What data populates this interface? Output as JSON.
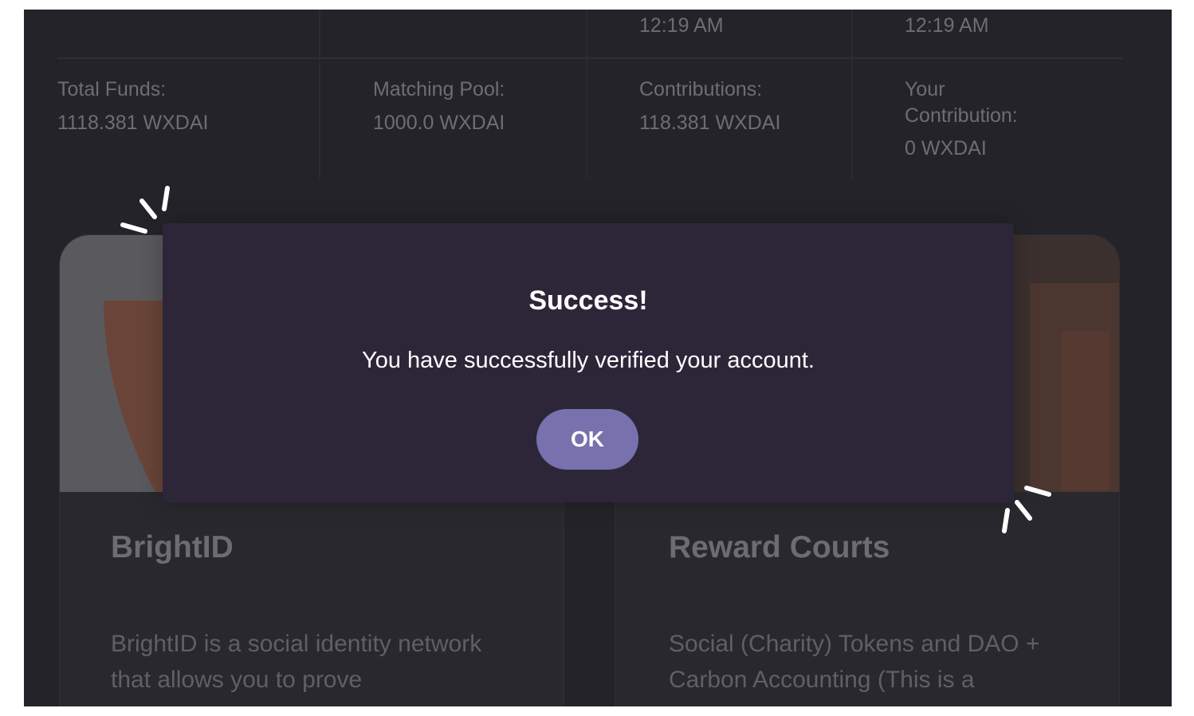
{
  "stats": {
    "times": [
      "12:19 AM",
      "12:19 AM"
    ],
    "items": [
      {
        "label": "Total Funds:",
        "value": "1118.381 WXDAI"
      },
      {
        "label": "Matching Pool:",
        "value": "1000.0 WXDAI"
      },
      {
        "label": "Contributions:",
        "value": "118.381 WXDAI"
      },
      {
        "label_line1": "Your",
        "label_line2": "Contribution:",
        "value": "0 WXDAI"
      }
    ]
  },
  "projects": [
    {
      "title": "BrightID",
      "description": "BrightID is a social identity network that allows you to prove",
      "description_cut": "..."
    },
    {
      "title": "Reward Courts",
      "description": "Social (Charity) Tokens and DAO + Carbon Accounting (This is a",
      "description_cut": "..."
    }
  ],
  "modal": {
    "title": "Success!",
    "message": "You have successfully verified your account.",
    "ok_label": "OK"
  },
  "colors": {
    "background": "#242329",
    "modal_background": "#2d2639",
    "button": "#7772ad"
  }
}
